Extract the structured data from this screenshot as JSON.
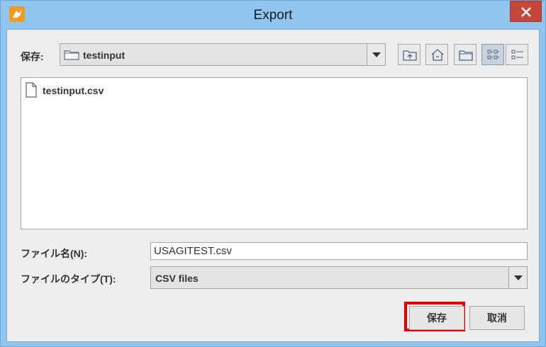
{
  "window": {
    "title": "Export",
    "app_icon": "app-icon",
    "close_icon": "close-icon"
  },
  "save_in": {
    "label": "保存:",
    "directory": "testinput",
    "icon": "folder-icon"
  },
  "toolbar": [
    {
      "name": "up-one-level-button",
      "icon": "up-folder-icon"
    },
    {
      "name": "home-button",
      "icon": "home-icon"
    },
    {
      "name": "new-folder-button",
      "icon": "new-folder-icon"
    },
    {
      "name": "list-view-button",
      "icon": "list-view-icon",
      "active": true
    },
    {
      "name": "details-view-button",
      "icon": "details-view-icon"
    }
  ],
  "files": [
    {
      "name": "testinput.csv",
      "icon": "file-icon"
    }
  ],
  "filename": {
    "label": "ファイル名(N):",
    "value": "USAGITEST.csv"
  },
  "filetype": {
    "label": "ファイルのタイプ(T):",
    "value": "CSV files"
  },
  "buttons": {
    "save": "保存",
    "cancel": "取消"
  },
  "colors": {
    "titlebar": "#8fc5ef",
    "close": "#c7463b",
    "highlight": "#e10000"
  }
}
